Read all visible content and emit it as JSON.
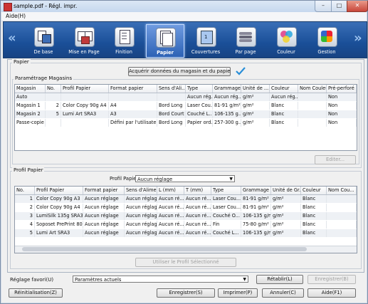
{
  "window": {
    "title": "sample.pdf - Régl. impr.",
    "close_glyph": "✕",
    "max_glyph": "□",
    "min_glyph": "–"
  },
  "menu": {
    "help": "Aide(H)"
  },
  "toolbar": {
    "left_arrow": "«",
    "right_arrow": "»",
    "items": [
      {
        "label": "De base",
        "icon": "basic-icon"
      },
      {
        "label": "Mise en Page",
        "icon": "layout-icon"
      },
      {
        "label": "Finition",
        "icon": "finishing-icon"
      },
      {
        "label": "Papier",
        "icon": "paper-icon"
      },
      {
        "label": "Couvertures",
        "icon": "covers-icon"
      },
      {
        "label": "Par page",
        "icon": "per-page-icon"
      },
      {
        "label": "Couleur",
        "icon": "color-icon"
      },
      {
        "label": "Gestion",
        "icon": "management-icon"
      }
    ],
    "selected": "Papier"
  },
  "paper_section": {
    "title": "Papier",
    "acquire_button": "Acquérir données du magasin et du papier",
    "tray_group_title": "Paramétrage Magasins",
    "tray_headers": [
      "Magasin",
      "No.",
      "Profil Papier",
      "Format papier",
      "Sens d'Ali...",
      "Type",
      "Grammage",
      "Unité de ...",
      "Couleur",
      "Nom Couleur",
      "Pré-perforé"
    ],
    "tray_rows": [
      [
        "Auto",
        "",
        "",
        "",
        "",
        "Aucun rég...",
        "Aucun rég...",
        "g/m²",
        "Aucun rég...",
        "",
        "Non"
      ],
      [
        "Magasin 1",
        "2",
        "Color Copy 90g A4",
        "A4",
        "Bord Long",
        "Laser Cou...",
        "81-91 g/m²",
        "g/m²",
        "Blanc",
        "",
        "Non"
      ],
      [
        "Magasin 2",
        "5",
        "Lumi Art SRA3",
        "A3",
        "Bord Court",
        "Couché L...",
        "106-135 g...",
        "g/m²",
        "Blanc",
        "",
        "Non"
      ],
      [
        "Passe-copie",
        "",
        "",
        "Défini par l'utilisateur",
        "Bord Long",
        "Papier ord...",
        "257-300 g...",
        "g/m²",
        "Blanc",
        "",
        "Non"
      ]
    ],
    "edit_button": "Editer..."
  },
  "profile_section": {
    "title": "Profil Papier",
    "dropdown_label": "Profil Papier",
    "dropdown_value": "Aucun réglage",
    "headers": [
      "No.",
      "Profil Papier",
      "Format papier",
      "Sens d'Alime...",
      "L (mm)",
      "T (mm)",
      "Type",
      "Grammage",
      "Unité de Gr...",
      "Couleur",
      "Nom Cou..."
    ],
    "rows": [
      [
        "1",
        "Color Copy 90g A3",
        "Aucun réglage",
        "Aucun réglage",
        "Aucun ré...",
        "Aucun ré...",
        "Laser Cou...",
        "81-91 g/m²",
        "g/m²",
        "Blanc",
        ""
      ],
      [
        "2",
        "Color Copy 90g A4",
        "Aucun réglage",
        "Aucun réglage",
        "Aucun ré...",
        "Aucun ré...",
        "Laser Cou...",
        "81-91 g/m²",
        "g/m²",
        "Blanc",
        ""
      ],
      [
        "3",
        "LumiSilk 135g SRA3",
        "Aucun réglage",
        "Aucun réglage",
        "Aucun ré...",
        "Aucun ré...",
        "Couché O...",
        "106-135 g/m²",
        "g/m²",
        "Blanc",
        ""
      ],
      [
        "4",
        "Soposet PrePrint 80...",
        "Aucun réglage",
        "Aucun réglage",
        "Aucun ré...",
        "Aucun ré...",
        "Fin",
        "75-80 g/m²",
        "g/m²",
        "Blanc",
        ""
      ],
      [
        "5",
        "Lumi Art SRA3",
        "Aucun réglage",
        "Aucun réglage",
        "Aucun ré...",
        "Aucun ré...",
        "Couché L...",
        "106-135 g/m²",
        "g/m²",
        "Blanc",
        ""
      ]
    ],
    "use_button": "Utiliser le Profil Sélectionné"
  },
  "bottom": {
    "favorite_label": "Réglage favori(U)",
    "favorite_value": "Paramètres actuels",
    "restore": "Rétablir(L)",
    "save_fav": "Enregistrer(B)",
    "reset": "Réinitialisation(Z)",
    "save": "Enregistrer(S)",
    "print": "Imprimer(P)",
    "cancel": "Annuler(C)",
    "help": "Aide(F1)"
  },
  "colors": {
    "toolbar": "#1a4f98",
    "accent": "#2a8fd8"
  }
}
